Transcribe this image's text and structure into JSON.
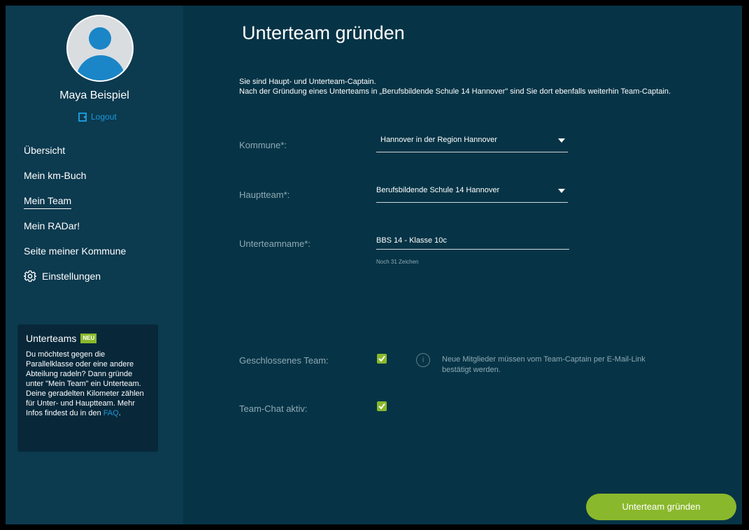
{
  "user": {
    "name": "Maya Beispiel",
    "logout_label": "Logout"
  },
  "nav": {
    "items": [
      {
        "label": "Übersicht"
      },
      {
        "label": "Mein km-Buch"
      },
      {
        "label": "Mein Team"
      },
      {
        "label": "Mein RADar!"
      },
      {
        "label": "Seite meiner Kommune"
      },
      {
        "label": "Einstellungen"
      }
    ],
    "active": "Mein Team"
  },
  "infobox": {
    "title": "Unterteams",
    "badge": "NEU",
    "text": "Du möchtest gegen die Parallelklasse oder eine andere Abteilung radeln? Dann gründe unter \"Mein Team\" ein Unterteam. Deine geradelten Kilometer zählen für Unter- und Hauptteam. Mehr Infos findest du in den ",
    "link": "FAQ",
    "suffix": "."
  },
  "page": {
    "title": "Unterteam gründen",
    "intro_line1": "Sie sind Haupt- und Unterteam-Captain.",
    "intro_line2": "Nach der Gründung eines Unterteams in „Berufsbildende Schule 14 Hannover\" sind Sie dort ebenfalls weiterhin Team-Captain."
  },
  "form": {
    "kommune": {
      "label": "Kommune*:",
      "value": "Hannover in der Region Hannover"
    },
    "hauptteam": {
      "label": "Hauptteam*:",
      "value": "Berufsbildende Schule 14 Hannover"
    },
    "unterteamname": {
      "label": "Unterteamname*:",
      "value": "BBS 14 - Klasse 10c",
      "hint": "Noch 31 Zeichen"
    },
    "geschlossen": {
      "label": "Geschlossenes Team:",
      "checked": true,
      "info": "Neue Mitglieder müssen vom Team-Captain per E-Mail-Link bestätigt werden."
    },
    "chat": {
      "label": "Team-Chat aktiv:",
      "checked": true
    },
    "submit_label": "Unterteam gründen"
  },
  "colors": {
    "accent_green": "#8ab82c",
    "link_blue": "#1a9ad8",
    "sidebar_bg": "#0c3a4f",
    "main_bg": "#063446"
  },
  "icons": [
    "avatar-icon",
    "logout-icon",
    "gear-icon",
    "chevron-down-icon",
    "info-icon",
    "checkmark-icon"
  ]
}
